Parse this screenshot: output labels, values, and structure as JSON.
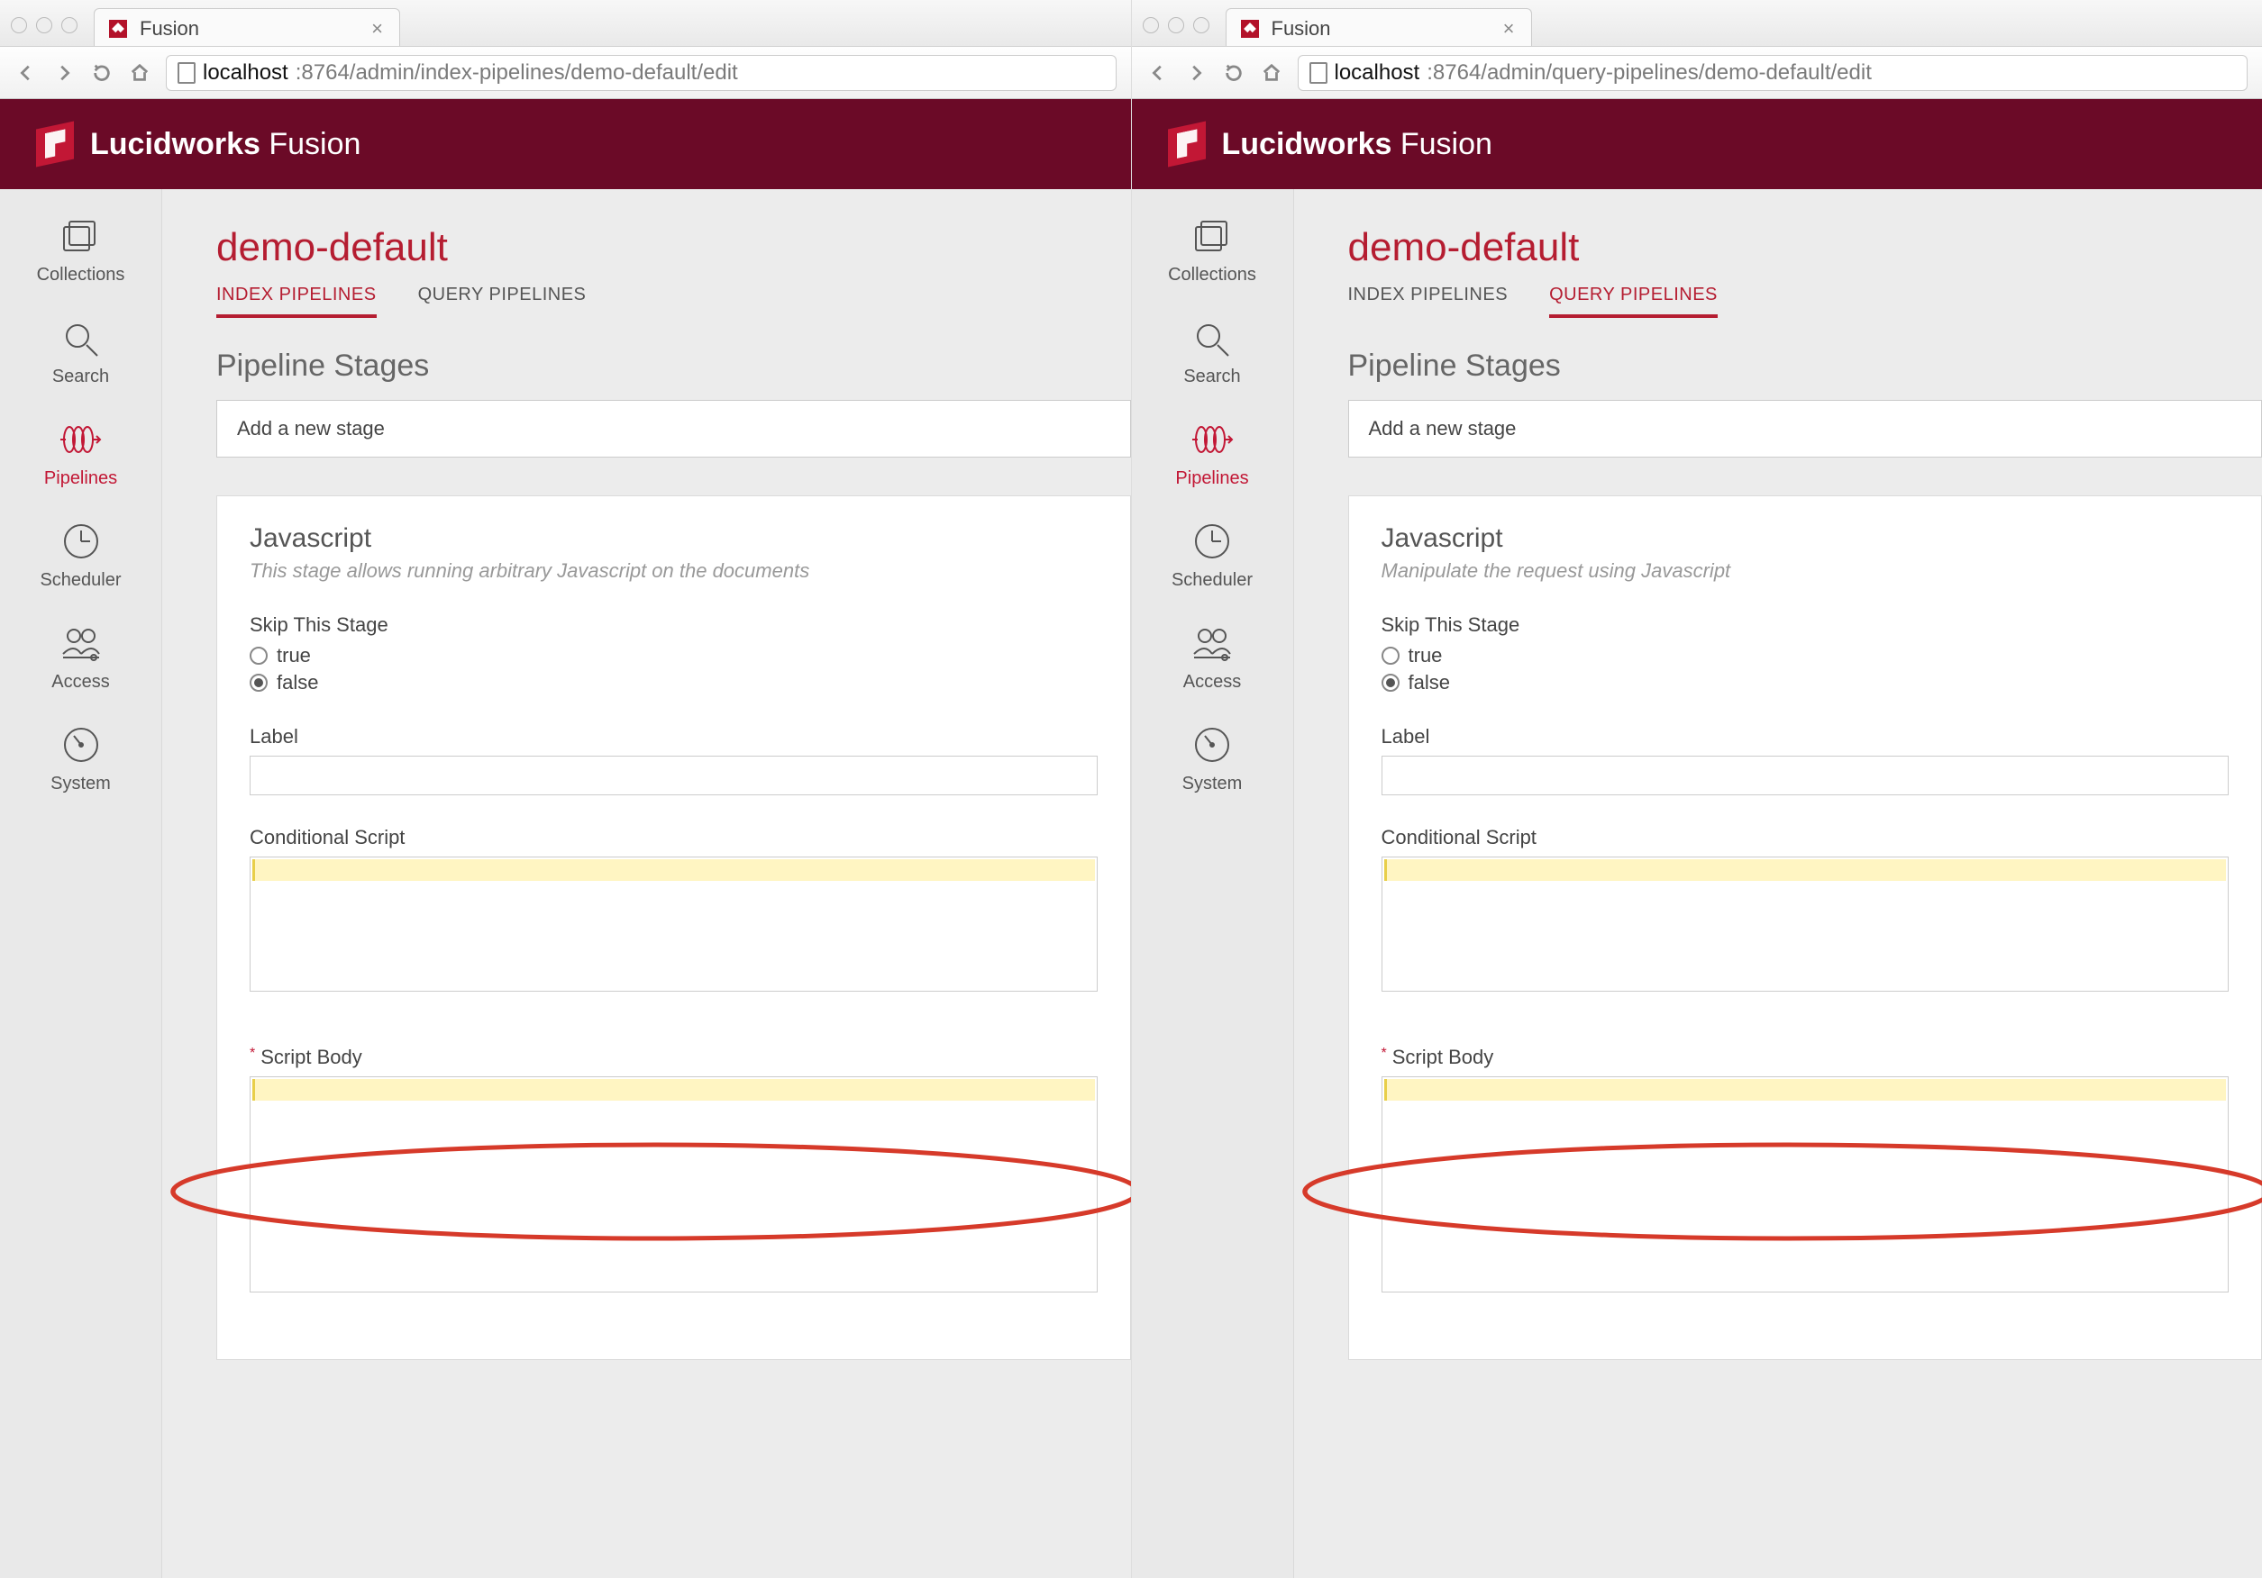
{
  "windows": [
    {
      "tab_title": "Fusion",
      "url_host": "localhost",
      "url_rest": ":8764/admin/index-pipelines/demo-default/edit",
      "logo_bold": "Lucidworks",
      "logo_light": " Fusion",
      "sidebar": [
        {
          "key": "collections",
          "label": "Collections"
        },
        {
          "key": "search",
          "label": "Search"
        },
        {
          "key": "pipelines",
          "label": "Pipelines",
          "active": true
        },
        {
          "key": "scheduler",
          "label": "Scheduler"
        },
        {
          "key": "access",
          "label": "Access"
        },
        {
          "key": "system",
          "label": "System"
        }
      ],
      "page_title": "demo-default",
      "tabs": [
        {
          "label": "INDEX PIPELINES",
          "active": true
        },
        {
          "label": "QUERY PIPELINES",
          "active": false
        }
      ],
      "section_title": "Pipeline Stages",
      "add_stage_label": "Add a new stage",
      "stage": {
        "name": "Javascript",
        "desc": "This stage allows running arbitrary Javascript on the documents",
        "skip_label": "Skip This Stage",
        "skip_true": "true",
        "skip_false": "false",
        "skip_value": "false",
        "label_label": "Label",
        "cond_label": "Conditional Script",
        "body_label": "Script Body",
        "body_required": true
      }
    },
    {
      "tab_title": "Fusion",
      "url_host": "localhost",
      "url_rest": ":8764/admin/query-pipelines/demo-default/edit",
      "logo_bold": "Lucidworks",
      "logo_light": " Fusion",
      "sidebar": [
        {
          "key": "collections",
          "label": "Collections"
        },
        {
          "key": "search",
          "label": "Search"
        },
        {
          "key": "pipelines",
          "label": "Pipelines",
          "active": true
        },
        {
          "key": "scheduler",
          "label": "Scheduler"
        },
        {
          "key": "access",
          "label": "Access"
        },
        {
          "key": "system",
          "label": "System"
        }
      ],
      "page_title": "demo-default",
      "tabs": [
        {
          "label": "INDEX PIPELINES",
          "active": false
        },
        {
          "label": "QUERY PIPELINES",
          "active": true
        }
      ],
      "section_title": "Pipeline Stages",
      "add_stage_label": "Add a new stage",
      "stage": {
        "name": "Javascript",
        "desc": "Manipulate the request using Javascript",
        "skip_label": "Skip This Stage",
        "skip_true": "true",
        "skip_false": "false",
        "skip_value": "false",
        "label_label": "Label",
        "cond_label": "Conditional Script",
        "body_label": "Script Body",
        "body_required": true
      }
    }
  ]
}
